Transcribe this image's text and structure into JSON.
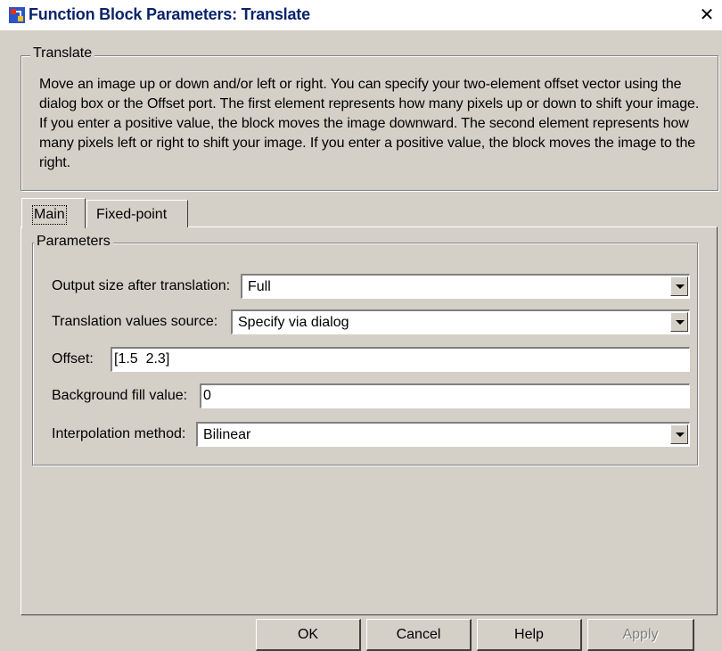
{
  "window": {
    "title": "Function Block Parameters: Translate",
    "close_glyph": "✕"
  },
  "block": {
    "group_label": "Translate",
    "description": "Move an image up or down and/or left or right. You can specify your two-element offset vector using the dialog box or the Offset port. The first element represents how many pixels up or down to shift your image. If you enter a positive value, the block moves the image downward.  The second element represents how many pixels left or right to shift your image. If you enter a positive value, the block moves the image to the right."
  },
  "tabs": [
    {
      "label": "Main",
      "active": true
    },
    {
      "label": "Fixed-point",
      "active": false
    }
  ],
  "parameters": {
    "group_label": "Parameters",
    "output_size": {
      "label": "Output size after translation:",
      "value": "Full"
    },
    "translation_source": {
      "label": "Translation values source:",
      "value": "Specify via dialog"
    },
    "offset": {
      "label": "Offset:",
      "value": "[1.5  2.3]"
    },
    "background_fill": {
      "label": "Background fill value:",
      "value": "0"
    },
    "interpolation": {
      "label": "Interpolation method:",
      "value": "Bilinear"
    }
  },
  "buttons": {
    "ok": "OK",
    "cancel": "Cancel",
    "help": "Help",
    "apply": "Apply"
  },
  "colors": {
    "window_bg": "#d4d0c8",
    "title_text": "#0a246a",
    "disabled_text": "#808080"
  },
  "icons": {
    "title": "simulink-block-icon",
    "dropdown": "chevron-down-icon",
    "close": "close-icon"
  }
}
